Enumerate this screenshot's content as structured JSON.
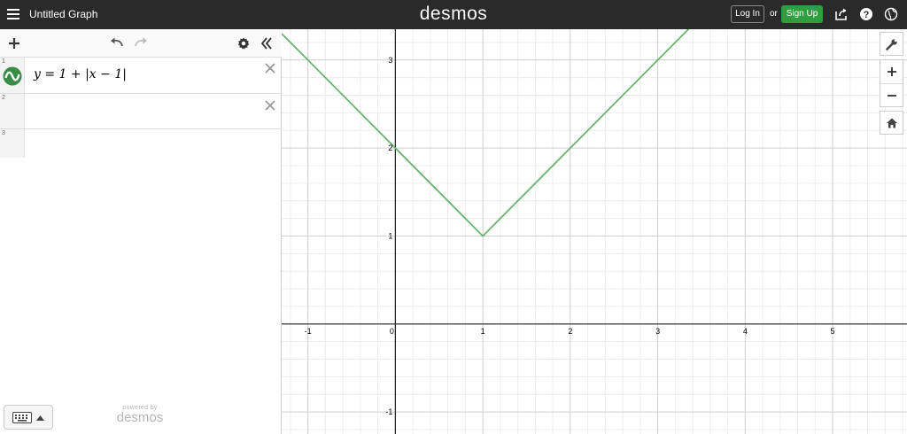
{
  "app": {
    "menu_icon": "hamburger-menu-icon",
    "title": "Untitled Graph",
    "brand": "desmos",
    "login_label": "Log In",
    "or_text": "or",
    "signup_label": "Sign Up",
    "header_icons": [
      "share-icon",
      "help-icon",
      "globe-icon"
    ],
    "accent_color": "#2f9e3f"
  },
  "panel": {
    "toolbar_icons": [
      "add-icon",
      "undo-icon",
      "redo-icon",
      "settings-icon",
      "collapse-panel-icon"
    ],
    "expressions": [
      {
        "number": "1",
        "latex": "y = 1 + |x − 1|",
        "color": "#388c46",
        "icon": "graph-color-icon"
      },
      {
        "number": "2",
        "latex": ""
      },
      {
        "number": "3",
        "latex": ""
      }
    ],
    "keyboard_icon": "keyboard-icon",
    "powered_by": "powered by",
    "powered_brand": "desmos"
  },
  "graph_controls": [
    "wrench-icon",
    "zoom-in-icon",
    "zoom-out-icon",
    "home-icon"
  ],
  "chart_data": {
    "type": "line",
    "title": "",
    "xlabel": "",
    "ylabel": "",
    "xlim": [
      -1.3,
      5.85
    ],
    "ylim": [
      -1.25,
      3.35
    ],
    "x_ticks": [
      "-1",
      "0",
      "1",
      "2",
      "3",
      "4",
      "5"
    ],
    "y_ticks": [
      "-1",
      "1",
      "2",
      "3"
    ],
    "grid": true,
    "series": [
      {
        "x": [
          -1.3,
          1,
          3.5
        ],
        "y": [
          3.3,
          1,
          3.5
        ],
        "color": "#6ab36e"
      }
    ]
  }
}
